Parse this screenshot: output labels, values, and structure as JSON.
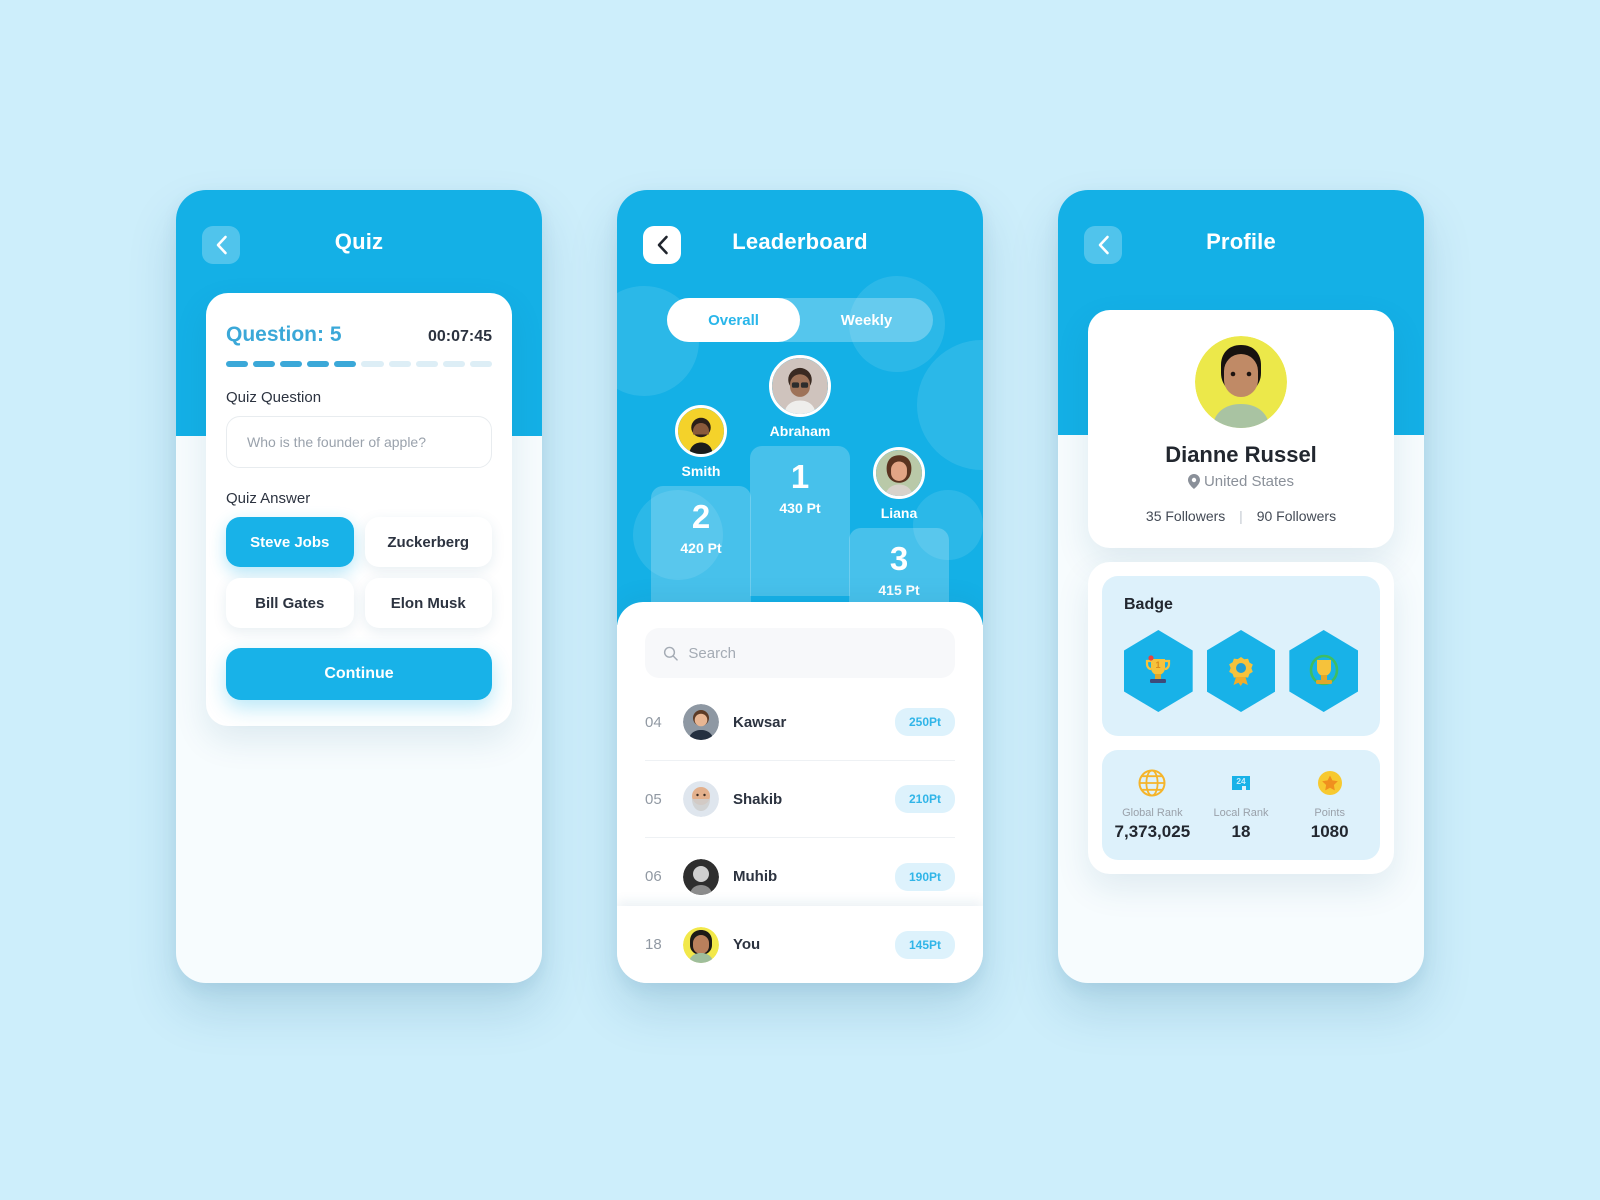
{
  "theme": {
    "page_bg": "#cdeefb",
    "header_blue": "#14b0e6",
    "accent": "#18b2e8",
    "pill_bg": "#ddf2fc",
    "pill_text": "#30b5e8"
  },
  "quiz": {
    "title": "Quiz",
    "question_label": "Question: 5",
    "timer": "00:07:45",
    "progress_total": 10,
    "progress_filled": 5,
    "question_field_label": "Quiz Question",
    "question_placeholder": "Who is the founder of apple?",
    "answer_field_label": "Quiz Answer",
    "answers": [
      {
        "label": "Steve Jobs",
        "selected": true
      },
      {
        "label": "Zuckerberg",
        "selected": false
      },
      {
        "label": "Bill Gates",
        "selected": false
      },
      {
        "label": "Elon Musk",
        "selected": false
      }
    ],
    "continue_label": "Continue"
  },
  "leaderboard": {
    "title": "Leaderboard",
    "tabs": [
      {
        "label": "Overall",
        "active": true
      },
      {
        "label": "Weekly",
        "active": false
      }
    ],
    "podium": [
      {
        "rank": "1",
        "name": "Abraham",
        "points": "430 Pt"
      },
      {
        "rank": "2",
        "name": "Smith",
        "points": "420 Pt"
      },
      {
        "rank": "3",
        "name": "Liana",
        "points": "415 Pt"
      }
    ],
    "search_placeholder": "Search",
    "rows": [
      {
        "index": "04",
        "name": "Kawsar",
        "points": "250Pt"
      },
      {
        "index": "05",
        "name": "Shakib",
        "points": "210Pt"
      },
      {
        "index": "06",
        "name": "Muhib",
        "points": "190Pt"
      }
    ],
    "you_row": {
      "index": "18",
      "name": "You",
      "points": "145Pt"
    }
  },
  "profile": {
    "title": "Profile",
    "name": "Dianne Russel",
    "location": "United States",
    "followers_left": "35 Followers",
    "followers_right": "90 Followers",
    "badge_title": "Badge",
    "badges": [
      {
        "icon": "trophy-badge-icon",
        "glyph": "🏆"
      },
      {
        "icon": "medal-rosette-icon",
        "glyph": "🎖"
      },
      {
        "icon": "trophy-globe-icon",
        "glyph": "🏆"
      }
    ],
    "stats": [
      {
        "icon": "globe-icon",
        "label": "Global Rank",
        "value": "7,373,025"
      },
      {
        "icon": "local-rank-icon",
        "label": "Local Rank",
        "value": "18"
      },
      {
        "icon": "star-icon",
        "label": "Points",
        "value": "1080"
      }
    ]
  }
}
